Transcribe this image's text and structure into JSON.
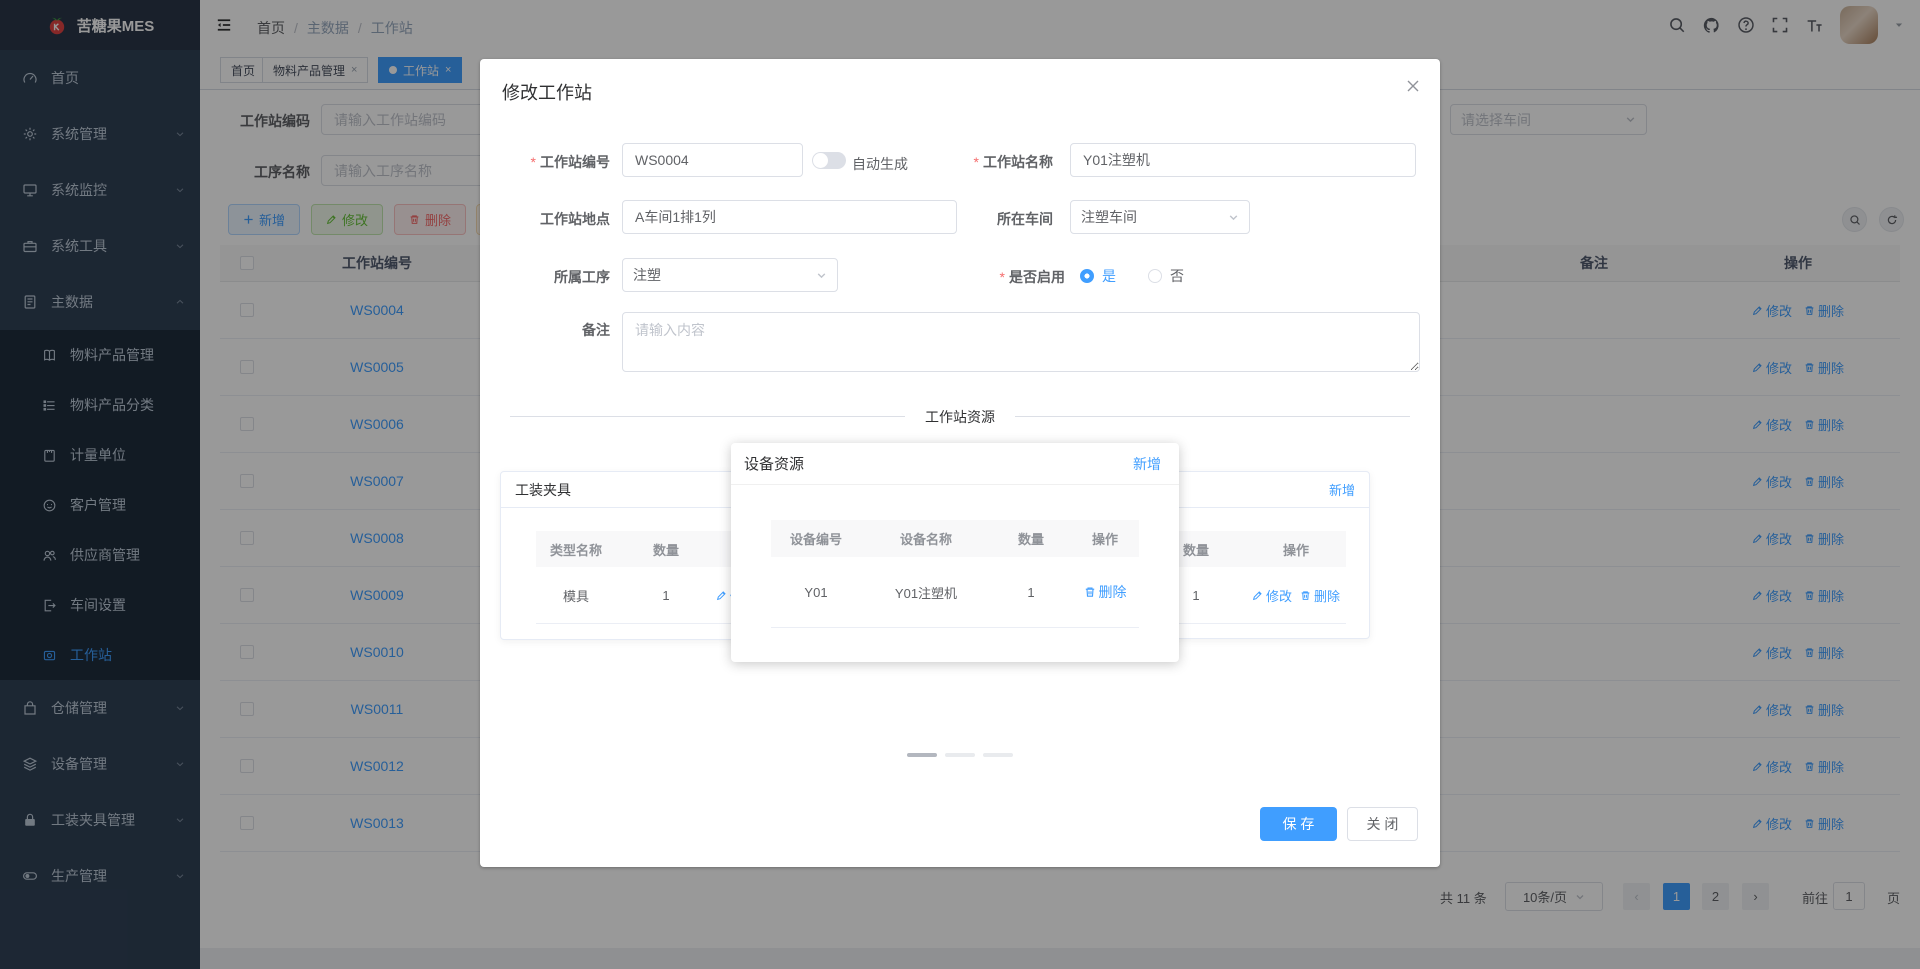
{
  "colors": {
    "accent": "#409eff",
    "success": "#67c23a",
    "danger": "#f56c6c",
    "warning": "#e6a23c",
    "sidebar-bg": "#304156",
    "sidebar-sub-bg": "#1f2d3d",
    "sidebar-text": "#bfcbd9"
  },
  "app": {
    "logo_text": "苦糖果MES"
  },
  "navbar": {
    "breadcrumb": [
      "首页",
      "主数据",
      "工作站"
    ],
    "separator": "/"
  },
  "tags": [
    {
      "label": "首页"
    },
    {
      "label": "物料产品管理",
      "close": "×"
    },
    {
      "label": "工作站",
      "close": "×"
    }
  ],
  "sidebar": {
    "items_top": [
      {
        "label": "首页"
      },
      {
        "label": "系统管理"
      },
      {
        "label": "系统监控"
      },
      {
        "label": "系统工具"
      }
    ],
    "master": {
      "label": "主数据",
      "children": [
        {
          "label": "物料产品管理"
        },
        {
          "label": "物料产品分类"
        },
        {
          "label": "计量单位"
        },
        {
          "label": "客户管理"
        },
        {
          "label": "供应商管理"
        },
        {
          "label": "车间设置"
        },
        {
          "label": "工作站"
        }
      ]
    },
    "items_bottom": [
      {
        "label": "仓储管理"
      },
      {
        "label": "设备管理"
      },
      {
        "label": "工装夹具管理"
      },
      {
        "label": "生产管理"
      }
    ]
  },
  "filters": {
    "code_label": "工作站编码",
    "code_placeholder": "请输入工作站编码",
    "process_label": "工序名称",
    "process_placeholder": "请输入工序名称",
    "workshop_placeholder": "请选择车间"
  },
  "toolbar": {
    "add": "新增",
    "edit": "修改",
    "delete": "删除"
  },
  "table": {
    "headers": {
      "code": "工作站编号",
      "remark": "备注",
      "actions": "操作"
    },
    "row_actions": {
      "edit": "修改",
      "delete": "删除"
    },
    "rows": [
      {
        "id": "WS0004"
      },
      {
        "id": "WS0005"
      },
      {
        "id": "WS0006"
      },
      {
        "id": "WS0007"
      },
      {
        "id": "WS0008"
      },
      {
        "id": "WS0009"
      },
      {
        "id": "WS0010"
      },
      {
        "id": "WS0011"
      },
      {
        "id": "WS0012"
      },
      {
        "id": "WS0013"
      }
    ]
  },
  "pagination": {
    "total": "共 11 条",
    "page_size": "10条/页",
    "prev": "‹",
    "next": "›",
    "page1": "1",
    "page2": "2",
    "goto_label": "前往",
    "goto_value": "1",
    "goto_unit": "页"
  },
  "dialog": {
    "title": "修改工作站",
    "required_mark": "*",
    "fields": {
      "code": {
        "label": "工作站编号",
        "value": "WS0004"
      },
      "auto": {
        "label": "自动生成"
      },
      "name": {
        "label": "工作站名称",
        "value": "Y01注塑机"
      },
      "location": {
        "label": "工作站地点",
        "value": "A车间1排1列"
      },
      "workshop": {
        "label": "所在车间",
        "value": "注塑车间"
      },
      "process": {
        "label": "所属工序",
        "value": "注塑"
      },
      "enabled": {
        "label": "是否启用",
        "yes": "是",
        "no": "否"
      },
      "remark": {
        "label": "备注",
        "placeholder": "请输入内容"
      }
    },
    "divider": "工作站资源",
    "fixture_card": {
      "title": "工装夹具",
      "col_type": "类型名称",
      "col_qty": "数量",
      "row_type": "模具",
      "row_qty": "1",
      "edit": "修改"
    },
    "right_card": {
      "add": "新增",
      "col_qty": "数量",
      "col_actions": "操作",
      "row_qty": "1",
      "edit": "修改",
      "delete": "删除"
    },
    "save": "保 存",
    "close_label": "关 闭"
  },
  "popup": {
    "title": "设备资源",
    "add": "新增",
    "headers": {
      "code": "设备编号",
      "name": "设备名称",
      "qty": "数量",
      "actions": "操作"
    },
    "row": {
      "code": "Y01",
      "name": "Y01注塑机",
      "qty": "1",
      "delete": "删除"
    }
  }
}
